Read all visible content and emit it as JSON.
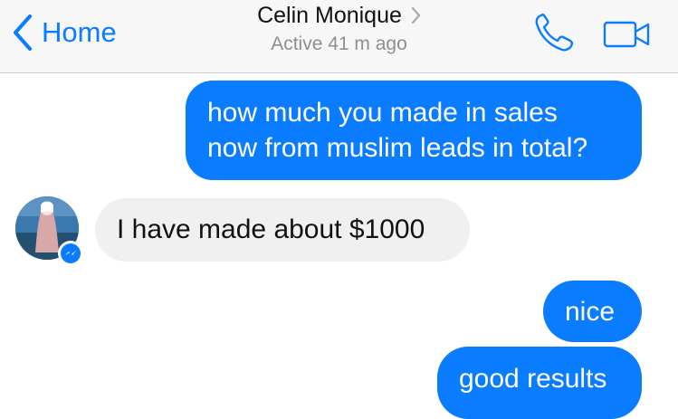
{
  "header": {
    "back_label": "Home",
    "contact_name": "Celin Monique",
    "status": "Active 41 m ago"
  },
  "colors": {
    "accent": "#0a7cff",
    "incoming_bubble": "#f1f0f0"
  },
  "icons": {
    "back": "chevron-left-icon",
    "details": "chevron-right-icon",
    "call": "phone-icon",
    "video": "video-camera-icon",
    "badge": "messenger-icon"
  },
  "messages": [
    {
      "from": "me",
      "lines": [
        "how much you made in sales",
        "now from muslim leads in total?"
      ]
    },
    {
      "from": "Celin Monique",
      "lines": [
        "I have made about $1000"
      ]
    },
    {
      "from": "me",
      "lines": [
        "nice"
      ]
    },
    {
      "from": "me",
      "lines": [
        "good results"
      ]
    }
  ]
}
